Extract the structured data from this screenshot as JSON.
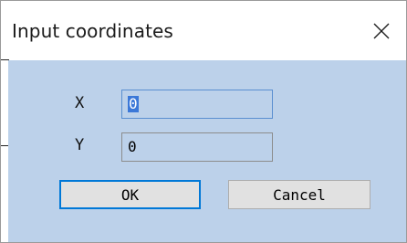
{
  "window": {
    "title": "Input coordinates"
  },
  "form": {
    "x_label": "X",
    "x_value": "0",
    "y_label": "Y",
    "y_value": "0"
  },
  "buttons": {
    "ok_label": "OK",
    "cancel_label": "Cancel"
  },
  "icons": {
    "close": "close-icon"
  },
  "colors": {
    "client_background": "#bcd1ea",
    "selection": "#3b78d8",
    "default_button_border": "#0078d7"
  }
}
